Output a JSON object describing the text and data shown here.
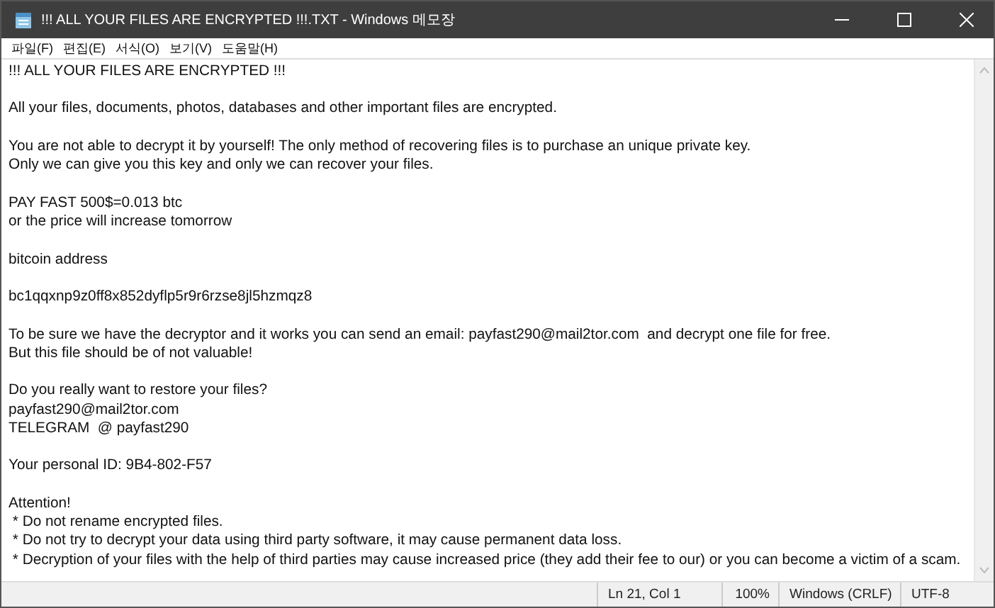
{
  "window": {
    "title": "!!! ALL YOUR FILES ARE ENCRYPTED !!!.TXT - Windows 메모장"
  },
  "menu": [
    "파일(F)",
    "편집(E)",
    "서식(O)",
    "보기(V)",
    "도움말(H)"
  ],
  "paragraphs": [
    [
      "!!! ALL YOUR FILES ARE ENCRYPTED !!!"
    ],
    [
      "All your files, documents, photos, databases and other important files are encrypted."
    ],
    [
      "You are not able to decrypt it by yourself! The only method of recovering files is to purchase an unique private key.",
      "Only we can give you this key and only we can recover your files."
    ],
    [
      "PAY FAST 500$=0.013 btc",
      "or the price will increase tomorrow"
    ],
    [
      "bitcoin address"
    ],
    [
      "bc1qqxnp9z0ff8x852dyflp5r9r6rzse8jl5hzmqz8"
    ],
    [
      "To be sure we have the decryptor and it works you can send an email: payfast290@mail2tor.com  and decrypt one file for free.",
      "But this file should be of not valuable!"
    ],
    [
      "Do you really want to restore your files?",
      "payfast290@mail2tor.com",
      "TELEGRAM  @ payfast290"
    ],
    [
      "Your personal ID: 9B4-802-F57"
    ],
    [
      "Attention!",
      " * Do not rename encrypted files.",
      " * Do not try to decrypt your data using third party software, it may cause permanent data loss.",
      " * Decryption of your files with the help of third parties may cause increased price (they add their fee to our) or you can become a victim of a scam."
    ]
  ],
  "status_bar": [
    "Ln 21, Col 1",
    "100%",
    "Windows (CRLF)",
    "UTF-8"
  ]
}
